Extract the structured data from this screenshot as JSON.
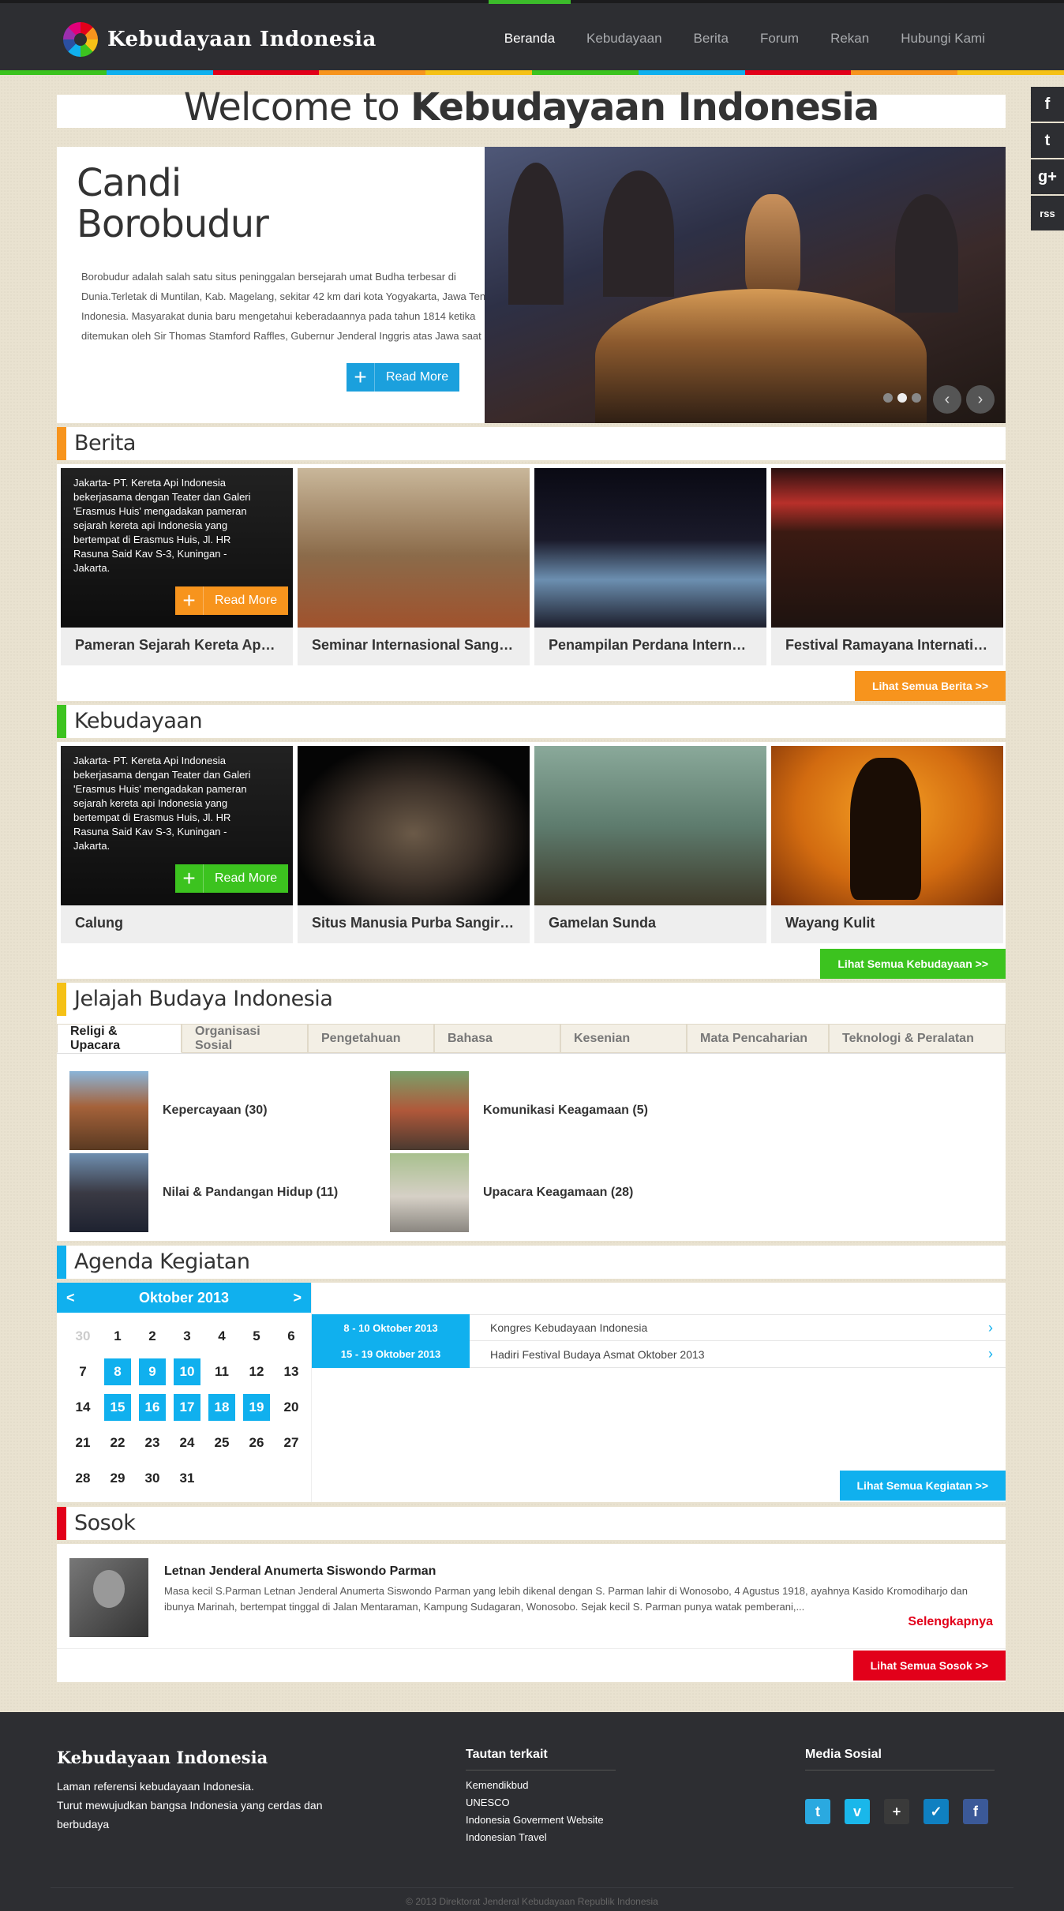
{
  "site": {
    "name": "Kebudayaan Indonesia"
  },
  "nav": {
    "items": [
      "Beranda",
      "Kebudayaan",
      "Berita",
      "Forum",
      "Rekan",
      "Hubungi Kami"
    ],
    "active": "Beranda"
  },
  "social_side": [
    "f",
    "t",
    "g+",
    "rss"
  ],
  "welcome": {
    "prefix": "Welcome to ",
    "bold": "Kebudayaan Indonesia"
  },
  "hero": {
    "title": "Candi Borobudur",
    "description": "Borobudur adalah salah satu situs peninggalan bersejarah umat Budha terbesar di Dunia.Terletak di Muntilan, Kab. Magelang, sekitar 42 km dari kota Yogyakarta, Jawa Tengah, Indonesia. Masyarakat dunia baru mengetahui keberadaannya pada tahun 1814 ketika ditemukan oleh Sir Thomas Stamford Raffles, Gubernur Jenderal Inggris atas Jawa saat itu.",
    "button": "Read More"
  },
  "berita": {
    "title": "Berita",
    "overlay_text": "Jakarta- PT. Kereta Api Indonesia bekerjasama dengan Teater dan Galeri 'Erasmus Huis' mengadakan pameran sejarah kereta api Indonesia yang bertempat di Erasmus Huis, Jl. HR Rasuna Said Kav S-3, Kuningan - Jakarta.",
    "overlay_button": "Read More",
    "cards": [
      "Pameran Sejarah Kereta Api ...",
      "Seminar Internasional Sangk ...",
      "Penampilan Perdana Interna ...",
      "Festival Ramayana Internati ..."
    ],
    "see_all": "Lihat Semua Berita >>"
  },
  "kebudayaan": {
    "title": "Kebudayaan",
    "overlay_text": "Jakarta- PT. Kereta Api Indonesia bekerjasama dengan Teater dan Galeri 'Erasmus Huis' mengadakan pameran sejarah kereta api Indonesia yang bertempat di Erasmus Huis, Jl. HR Rasuna Said Kav S-3, Kuningan - Jakarta.",
    "overlay_button": "Read More",
    "cards": [
      "Calung",
      "Situs Manusia Purba Sangiran",
      "Gamelan Sunda",
      "Wayang Kulit"
    ],
    "see_all": "Lihat Semua Kebudayaan >>"
  },
  "jelajah": {
    "title": "Jelajah Budaya Indonesia",
    "tabs": [
      "Religi & Upacara",
      "Organisasi Sosial",
      "Pengetahuan",
      "Bahasa",
      "Kesenian",
      "Mata Pencaharian",
      "Teknologi & Peralatan"
    ],
    "active_tab": "Religi & Upacara",
    "items": [
      "Kepercayaan (30)",
      "Komunikasi Keagamaan (5)",
      "Nilai & Pandangan Hidup (11)",
      "Upacara Keagamaan (28)"
    ]
  },
  "agenda": {
    "title": "Agenda Kegiatan",
    "month": "Oktober 2013",
    "prev": "<",
    "next": ">",
    "days": [
      "30",
      "1",
      "2",
      "3",
      "4",
      "5",
      "6",
      "7",
      "8",
      "9",
      "10",
      "11",
      "12",
      "13",
      "14",
      "15",
      "16",
      "17",
      "18",
      "19",
      "20",
      "21",
      "22",
      "23",
      "24",
      "25",
      "26",
      "27",
      "28",
      "29",
      "30",
      "31"
    ],
    "event_days": [
      "8",
      "9",
      "10",
      "15",
      "16",
      "17",
      "18",
      "19"
    ],
    "events": [
      {
        "date": "8 - 10 Oktober 2013",
        "title": "Kongres Kebudayaan Indonesia"
      },
      {
        "date": "15 - 19 Oktober 2013",
        "title": "Hadiri Festival Budaya Asmat Oktober 2013"
      }
    ],
    "see_all": "Lihat Semua Kegiatan >>"
  },
  "sosok": {
    "title": "Sosok",
    "name": "Letnan Jenderal Anumerta Siswondo Parman",
    "description": "Masa kecil S.Parman Letnan Jenderal Anumerta Siswondo Parman yang lebih dikenal dengan S. Parman lahir di Wonosobo, 4 Agustus 1918, ayahnya Kasido Kromodiharjo dan ibunya Marinah, bertempat tinggal di Jalan Mentaraman, Kampung Sudagaran, Wonosobo. Sejak kecil S. Parman punya watak pemberani,...",
    "more": "Selengkapnya",
    "see_all": "Lihat Semua Sosok >>"
  },
  "footer": {
    "logo": "Kebudayaan Indonesia",
    "desc_line1": "Laman referensi kebudayaan Indonesia.",
    "desc_line2": "Turut mewujudkan bangsa Indonesia yang cerdas dan berbudaya",
    "links_title": "Tautan terkait",
    "links": [
      "Kemendikbud",
      "UNESCO",
      "Indonesia Goverment Website",
      "Indonesian Travel"
    ],
    "social_title": "Media Sosial",
    "social": [
      {
        "icon": "twitter-icon",
        "glyph": "t",
        "color": "#2aa9e0"
      },
      {
        "icon": "vimeo-icon",
        "glyph": "v",
        "color": "#1ab7ea"
      },
      {
        "icon": "google-plus-icon",
        "glyph": "+",
        "color": "#3a3a3a"
      },
      {
        "icon": "foursquare-icon",
        "glyph": "✓",
        "color": "#0f80c1"
      },
      {
        "icon": "facebook-icon",
        "glyph": "f",
        "color": "#3b5998"
      }
    ],
    "copyright": "© 2013 Direktorat Jenderal Kebudayaan Republik Indonesia"
  },
  "colors": {
    "orange": "#f7941d",
    "green": "#3cc31f",
    "yellow": "#f5c116",
    "blue": "#10b0ee",
    "red": "#e2001a",
    "header": "#2d2e32"
  }
}
